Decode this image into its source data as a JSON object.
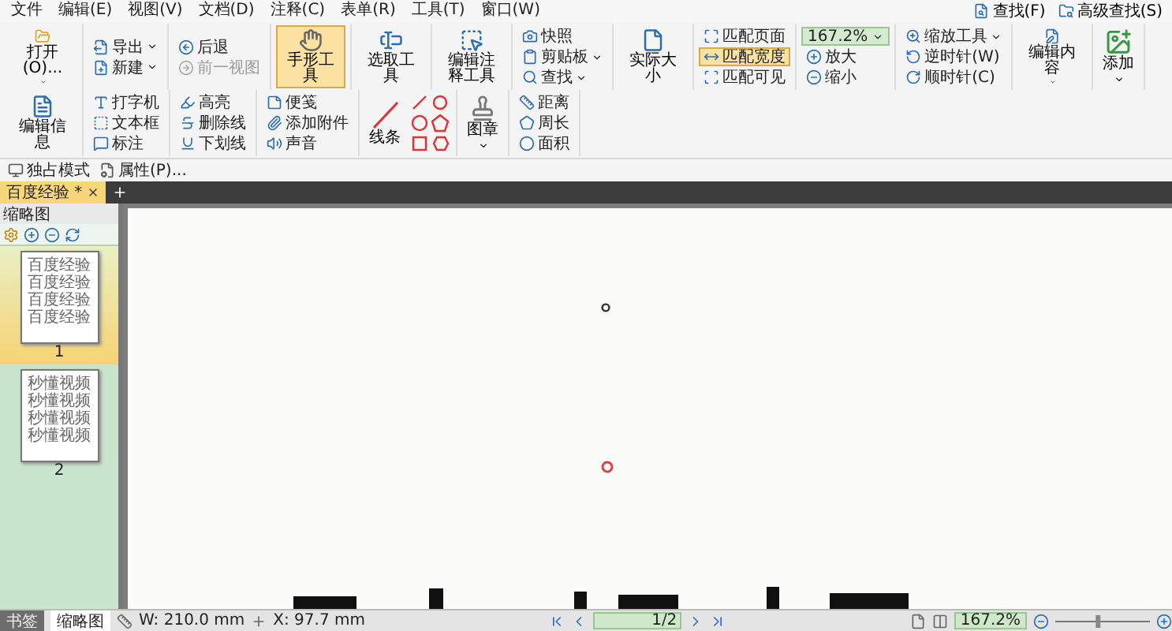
{
  "menu": [
    "文件",
    "编辑(E)",
    "视图(V)",
    "文档(D)",
    "注释(C)",
    "表单(R)",
    "工具(T)",
    "窗口(W)"
  ],
  "search_links": [
    "查找(F)",
    "高级查找(S)"
  ],
  "ribbon": [
    {
      "kind": "big",
      "label": "打开(O)...",
      "selected": false,
      "dropdown": true
    },
    {
      "kind": "stack",
      "items": [
        {
          "kind": "button",
          "label": "导出",
          "dropdown": true
        },
        {
          "kind": "button",
          "label": "新建",
          "dropdown": true
        }
      ]
    },
    {
      "kind": "stack",
      "items": [
        {
          "kind": "button",
          "label": "后退",
          "disabled": false
        },
        {
          "kind": "button",
          "label": "前一视图",
          "disabled": true
        }
      ]
    },
    {
      "kind": "big",
      "label": "手形工具",
      "selected": true,
      "dropdown": false
    },
    {
      "kind": "big",
      "label": "选取工具",
      "selected": false,
      "dropdown": false
    },
    {
      "kind": "big",
      "label": "编辑注释工具",
      "selected": false,
      "dropdown": false
    },
    {
      "kind": "stack",
      "items": [
        {
          "kind": "button",
          "label": "快照"
        },
        {
          "kind": "button",
          "label": "剪贴板",
          "dropdown": true
        },
        {
          "kind": "button",
          "label": "查找",
          "dropdown": true
        }
      ]
    },
    {
      "kind": "big",
      "label": "实际大小",
      "selected": false,
      "dropdown": false
    },
    {
      "kind": "stack",
      "items": [
        {
          "kind": "button",
          "label": "匹配页面",
          "selected": false
        },
        {
          "kind": "button",
          "label": "匹配宽度",
          "selected": true
        },
        {
          "kind": "button",
          "label": "匹配可见",
          "selected": false
        }
      ]
    },
    {
      "kind": "stack",
      "items": [
        {
          "kind": "combo",
          "value": "167.2%"
        },
        {
          "kind": "button",
          "label": "放大"
        },
        {
          "kind": "button",
          "label": "缩小"
        }
      ]
    },
    {
      "kind": "stack",
      "items": [
        {
          "kind": "button",
          "label": "缩放工具",
          "dropdown": true
        },
        {
          "kind": "button",
          "label": "逆时针(W)"
        },
        {
          "kind": "button",
          "label": "顺时针(C)"
        }
      ]
    },
    {
      "kind": "big",
      "label": "编辑内容",
      "selected": false,
      "dropdown": true
    },
    {
      "kind": "big",
      "label": "添加",
      "selected": false,
      "dropdown": true
    },
    {
      "kind": "big",
      "label": "编辑信息",
      "selected": false,
      "dropdown": false
    },
    {
      "kind": "stack",
      "items": [
        {
          "kind": "button",
          "label": "打字机"
        },
        {
          "kind": "button",
          "label": "文本框"
        },
        {
          "kind": "button",
          "label": "标注"
        }
      ]
    },
    {
      "kind": "stack",
      "items": [
        {
          "kind": "button",
          "label": "高亮"
        },
        {
          "kind": "button",
          "label": "删除线"
        },
        {
          "kind": "button",
          "label": "下划线"
        }
      ]
    },
    {
      "kind": "stack",
      "items": [
        {
          "kind": "button",
          "label": "便笺"
        },
        {
          "kind": "button",
          "label": "添加附件"
        },
        {
          "kind": "button",
          "label": "声音"
        }
      ]
    },
    {
      "kind": "shapes",
      "label": "线条"
    },
    {
      "kind": "big",
      "label": "图章",
      "selected": false,
      "dropdown": true
    },
    {
      "kind": "stack",
      "items": [
        {
          "kind": "button",
          "label": "距离"
        },
        {
          "kind": "button",
          "label": "周长"
        },
        {
          "kind": "button",
          "label": "面积"
        }
      ]
    }
  ],
  "toolbar_row": [
    "独占模式",
    "属性(P)..."
  ],
  "tabs": [
    {
      "label": "百度经验 *",
      "selected": true
    }
  ],
  "sidebar": {
    "title": "缩略图",
    "thumbnails": [
      {
        "page": "1",
        "selected": true,
        "lines": [
          "百度经验",
          "百度经验",
          "百度经验",
          "百度经验"
        ]
      },
      {
        "page": "2",
        "selected": false,
        "lines": [
          "秒懂视频",
          "秒懂视频",
          "秒懂视频",
          "秒懂视频"
        ]
      }
    ]
  },
  "status_bar": {
    "panel_tabs": [
      {
        "label": "书签",
        "selected": false
      },
      {
        "label": "缩略图",
        "selected": true
      }
    ],
    "width": "W: 210.0 mm",
    "x": "X: 97.7 mm",
    "page": "1/2",
    "zoom": "167.2%",
    "zoom_slider": {
      "level": 0.45
    }
  }
}
